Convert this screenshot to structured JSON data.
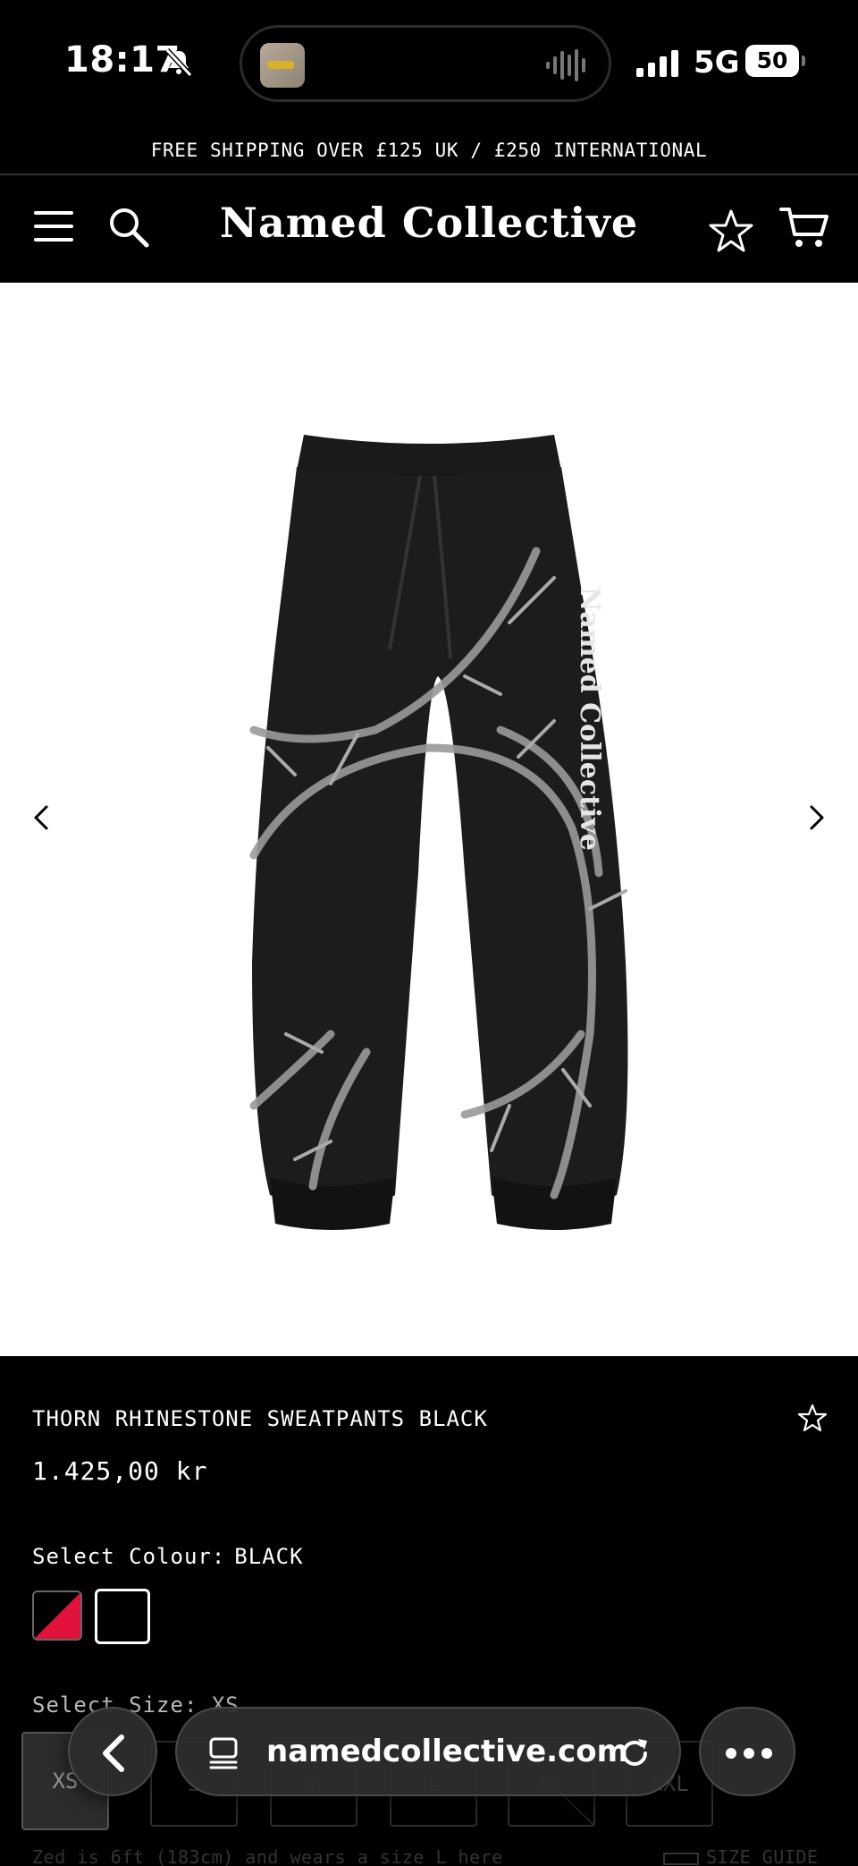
{
  "status_bar": {
    "time": "18:17",
    "network": "5G",
    "battery": "50"
  },
  "announcement": "FREE SHIPPING OVER £125 UK / £250 INTERNATIONAL",
  "header": {
    "logo": "Named Collective"
  },
  "product": {
    "title": "THORN RHINESTONE SWEATPANTS BLACK",
    "price": "1.425,00 kr",
    "colour_label": "Select Colour:",
    "colour_value": "BLACK",
    "swatches": [
      {
        "name": "red",
        "color": "#e0113a"
      },
      {
        "name": "black",
        "color": "#000000"
      }
    ],
    "size_label": "Select Size: XS",
    "sizes": [
      "XS",
      "S",
      "M",
      "L",
      "XL",
      "XXL"
    ],
    "selected_size": "XS",
    "model_note": "Zed is 6ft (183cm) and wears a size L here",
    "size_guide": "SIZE GUIDE"
  },
  "browser": {
    "url": "namedcollective.com"
  },
  "colors": {
    "background": "#000000",
    "text": "#ffffff",
    "accent_red": "#e0113a"
  }
}
